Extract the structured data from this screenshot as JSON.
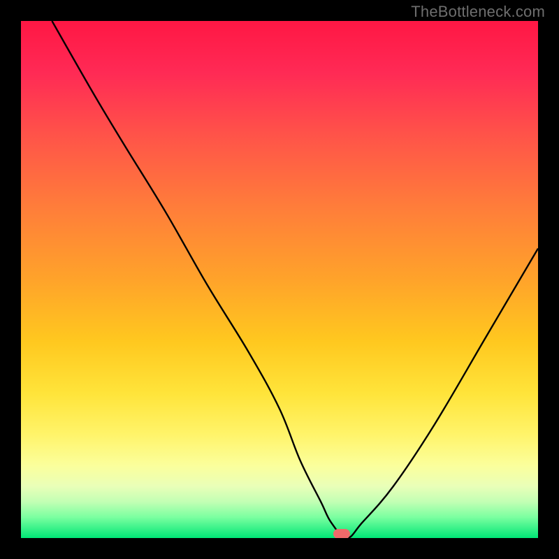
{
  "watermark": "TheBottleneck.com",
  "chart_data": {
    "type": "line",
    "title": "",
    "xlabel": "",
    "ylabel": "",
    "xlim": [
      0,
      100
    ],
    "ylim": [
      0,
      100
    ],
    "legend": false,
    "grid": false,
    "background": "vertical-gradient red→orange→yellow→green",
    "series": [
      {
        "name": "bottleneck-curve",
        "x": [
          6,
          14,
          20,
          28,
          36,
          44,
          50,
          54,
          58,
          60,
          63,
          66,
          72,
          80,
          90,
          100
        ],
        "values": [
          100,
          86,
          76,
          63,
          49,
          36,
          25,
          15,
          7,
          3,
          0,
          3,
          10,
          22,
          39,
          56
        ]
      }
    ],
    "marker": {
      "x": 62,
      "y": 0,
      "color": "#ef6a6a",
      "shape": "pill"
    }
  },
  "colors": {
    "background_black": "#000000",
    "gradient_top": "#ff1744",
    "gradient_mid": "#ffe43a",
    "gradient_bottom": "#00e676",
    "curve": "#000000",
    "marker": "#ef6a6a",
    "watermark": "#6e6e6e"
  }
}
